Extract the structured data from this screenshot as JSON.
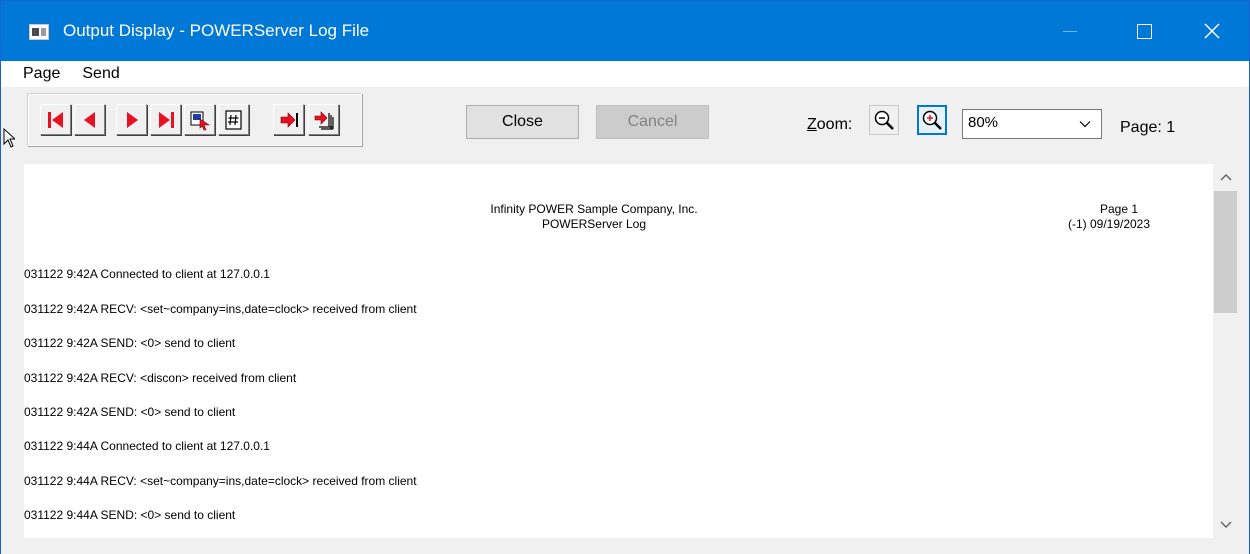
{
  "window": {
    "title": "Output Display - POWERServer Log File",
    "controls": {
      "minimize": "minimize",
      "maximize": "maximize",
      "close": "close"
    }
  },
  "menu": {
    "items": [
      "Page",
      "Send"
    ]
  },
  "toolbar": {
    "nav_icons": [
      "first-page-icon",
      "previous-page-icon",
      "next-page-icon",
      "last-page-icon",
      "goto-page-icon",
      "page-number-icon",
      "export-icon",
      "export-all-icon"
    ],
    "close_label": "Close",
    "cancel_label": "Cancel",
    "zoom_label_prefix": "Z",
    "zoom_label_rest": "oom:",
    "zoom_value": "80%",
    "page_label": "Page: 1"
  },
  "report": {
    "company": "Infinity POWER Sample Company, Inc.",
    "title": "POWERServer Log",
    "page": "Page  1",
    "date": "(-1)  09/19/2023",
    "lines": [
      "031122  9:42A Connected to client at 127.0.0.1",
      "031122  9:42A RECV: <set~company=ins,date=clock> received from client",
      "031122  9:42A SEND: <0> send to client",
      "031122  9:42A RECV: <discon> received from client",
      "031122  9:42A SEND: <0> send to client",
      "031122  9:44A Connected to client at 127.0.0.1",
      "031122  9:44A RECV: <set~company=ins,date=clock> received from client",
      "031122  9:44A SEND: <0> send to client"
    ]
  },
  "colors": {
    "titlebar": "#0078d7",
    "accent_red": "#e81123"
  }
}
